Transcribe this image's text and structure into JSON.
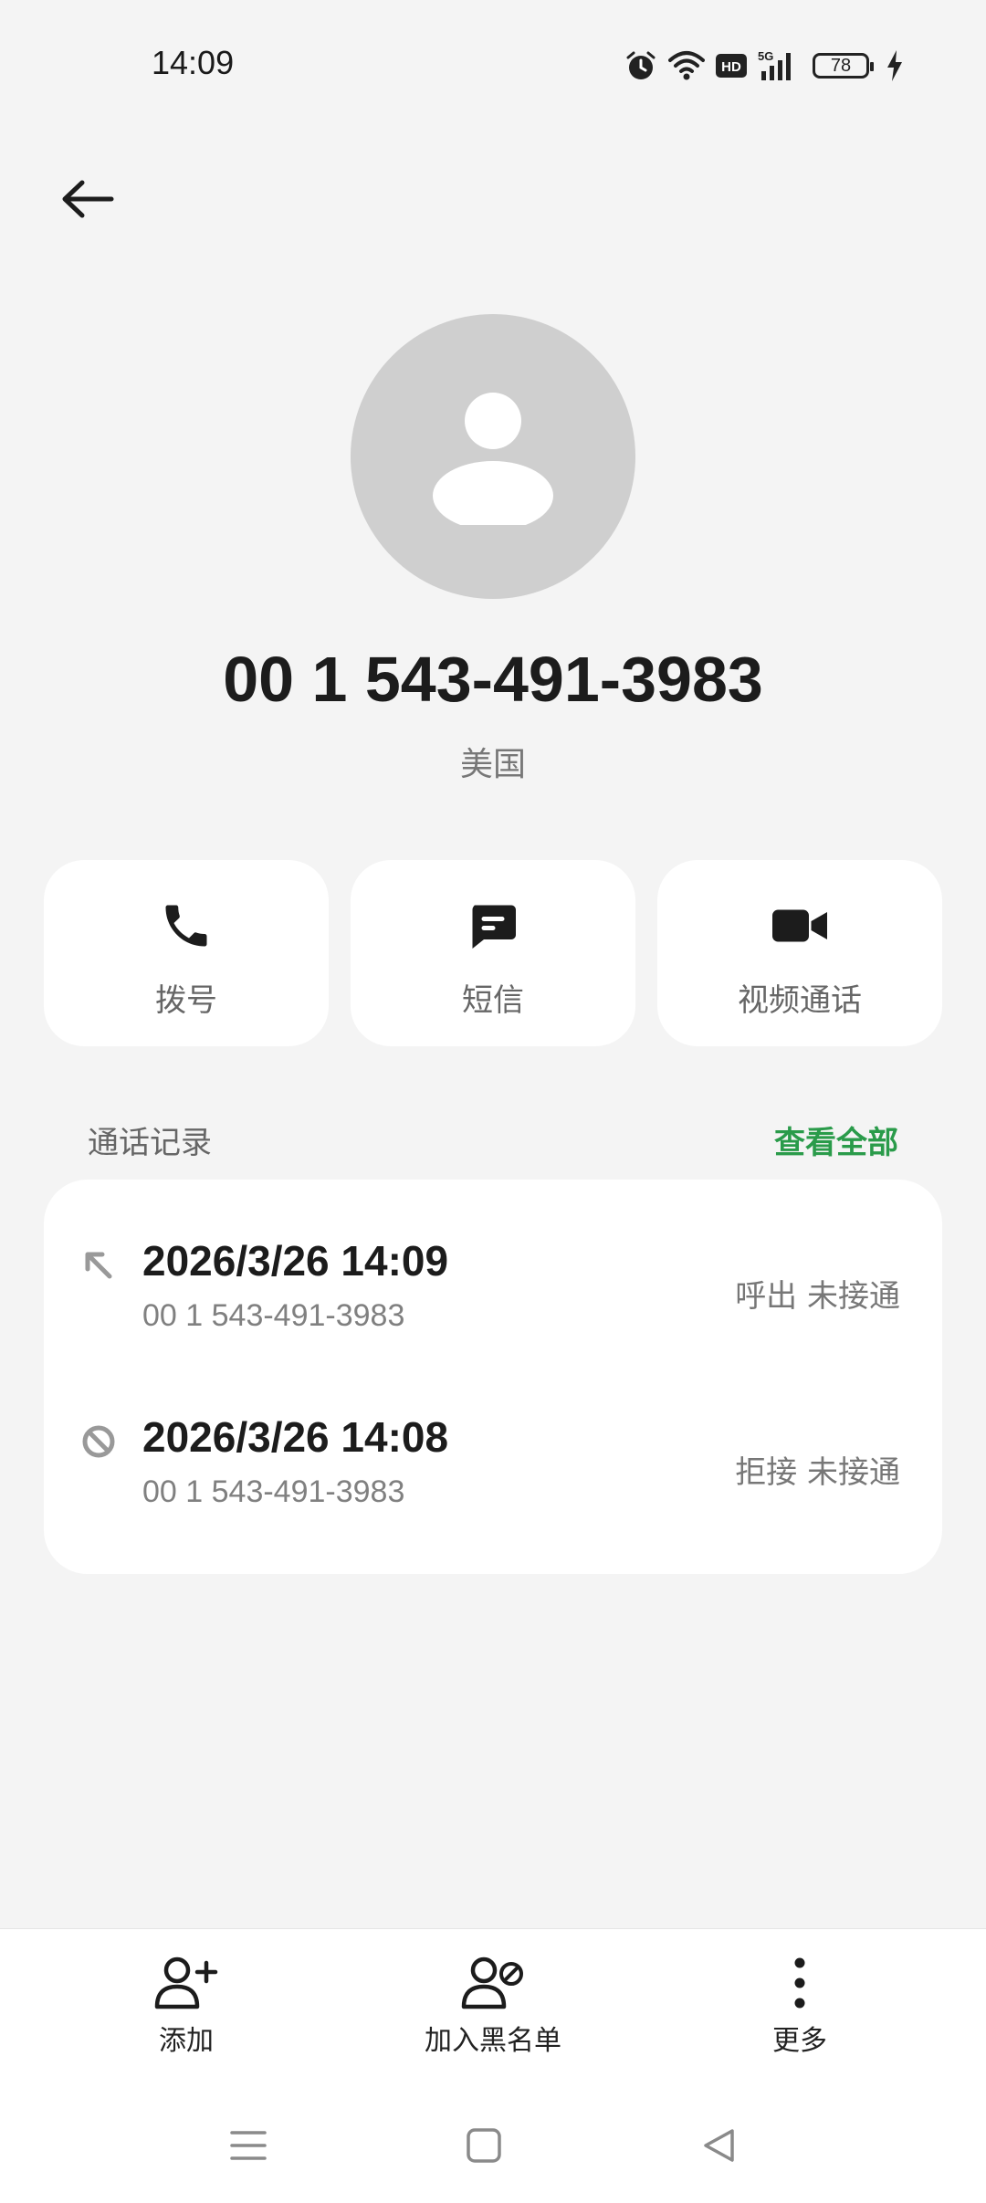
{
  "status_bar": {
    "time": "14:09",
    "network": "5G",
    "hd_label": "HD",
    "battery": "78",
    "icons": [
      "alarm-icon",
      "wifi-icon",
      "hd-icon",
      "signal-icon",
      "battery-icon",
      "charging-icon"
    ]
  },
  "header": {
    "back_icon": "arrow-left-icon"
  },
  "contact": {
    "number": "00 1 543-491-3983",
    "location": "美国",
    "avatar_icon": "person-icon"
  },
  "actions": [
    {
      "label": "拨号",
      "icon": "phone-icon"
    },
    {
      "label": "短信",
      "icon": "message-icon"
    },
    {
      "label": "视频通话",
      "icon": "video-icon"
    }
  ],
  "call_log": {
    "title": "通话记录",
    "view_all": "查看全部",
    "entries": [
      {
        "datetime": "2026/3/26 14:09",
        "number": "00 1 543-491-3983",
        "status": "呼出 未接通",
        "icon": "outgoing-call-icon"
      },
      {
        "datetime": "2026/3/26 14:08",
        "number": "00 1 543-491-3983",
        "status": "拒接 未接通",
        "icon": "blocked-call-icon"
      }
    ]
  },
  "bottom_actions": [
    {
      "label": "添加",
      "icon": "add-contact-icon"
    },
    {
      "label": "加入黑名单",
      "icon": "block-contact-icon"
    },
    {
      "label": "更多",
      "icon": "more-vertical-icon"
    }
  ],
  "nav_bar": [
    "menu-icon",
    "home-icon",
    "back-triangle-icon"
  ],
  "colors": {
    "background": "#f4f4f4",
    "card": "#ffffff",
    "accent_green": "#2a9b4a",
    "avatar": "#cfcfcf"
  }
}
